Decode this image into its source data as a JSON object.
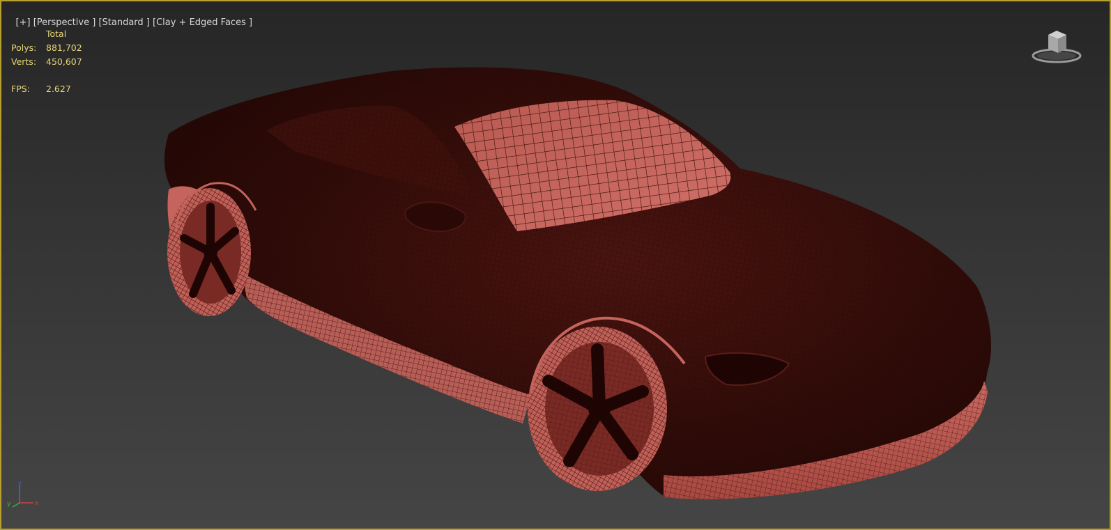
{
  "viewport": {
    "label_plus": "[+]",
    "label_view": "[Perspective ]",
    "label_shading_preset": "[Standard ]",
    "label_shading_mode": "[Clay + Edged Faces ]"
  },
  "stats": {
    "header": "Total",
    "polys_label": "Polys:",
    "polys_value": "881,702",
    "verts_label": "Verts:",
    "verts_value": "450,607",
    "fps_label": "FPS:",
    "fps_value": "2.627"
  },
  "axis": {
    "x_label": "x",
    "y_label": "y",
    "z_label": "z"
  },
  "colors": {
    "viewport_border": "#b8a030",
    "stats_text": "#e7d77a",
    "clay_light": "#c8685f",
    "clay_dark": "#2a0a08",
    "wire": "#3a0d0a"
  },
  "icons": {
    "viewcube": "viewcube-icon",
    "axis": "axis-tripod-icon"
  }
}
